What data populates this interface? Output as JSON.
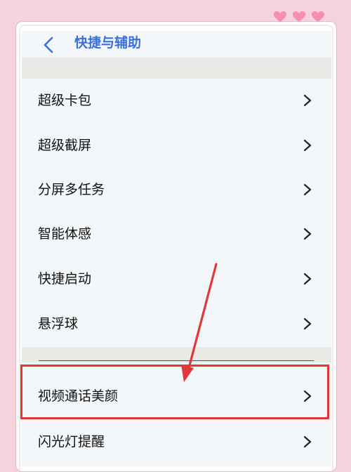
{
  "header": {
    "title": "快捷与辅助"
  },
  "menu_group_1": [
    {
      "label": "超级卡包"
    },
    {
      "label": "超级截屏"
    },
    {
      "label": "分屏多任务"
    },
    {
      "label": "智能体感"
    },
    {
      "label": "快捷启动"
    },
    {
      "label": "悬浮球"
    }
  ],
  "menu_group_2": [
    {
      "label": "视频通话美颜"
    },
    {
      "label": "闪光灯提醒"
    }
  ],
  "decorations": {
    "heart_color": "#f48fb1",
    "annotation_color": "#e4343c",
    "accent_color": "#3b6fd9"
  }
}
